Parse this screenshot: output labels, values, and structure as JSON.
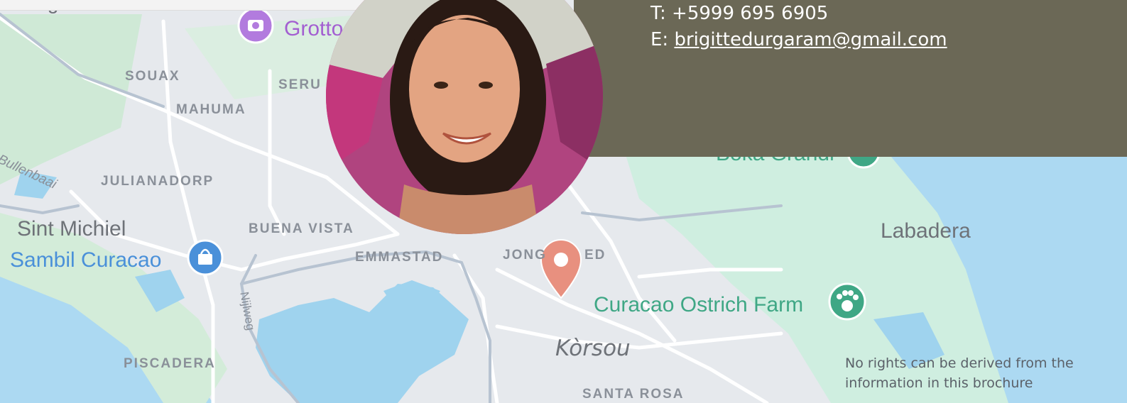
{
  "map": {
    "places": [
      {
        "id": "souax",
        "label": "SOUAX",
        "kind": "district"
      },
      {
        "id": "seru",
        "label": "SERU",
        "kind": "district"
      },
      {
        "id": "mahuma",
        "label": "MAHUMA",
        "kind": "district"
      },
      {
        "id": "julianadorp",
        "label": "JULIANADORP",
        "kind": "district"
      },
      {
        "id": "buena-vista",
        "label": "BUENA VISTA",
        "kind": "district"
      },
      {
        "id": "emmastad",
        "label": "EMMASTAD",
        "kind": "district"
      },
      {
        "id": "jongbloed-start",
        "label": "JONG",
        "kind": "district"
      },
      {
        "id": "jongbloed-end",
        "label": "ED",
        "kind": "district"
      },
      {
        "id": "piscadera",
        "label": "PISCADERA",
        "kind": "district"
      },
      {
        "id": "santa-rosa",
        "label": "SANTA ROSA",
        "kind": "district"
      },
      {
        "id": "sint-michiel",
        "label": "Sint Michiel",
        "kind": "town"
      },
      {
        "id": "labadera",
        "label": "Labadera",
        "kind": "town"
      },
      {
        "id": "korsou",
        "label": "Kòrsou",
        "kind": "region"
      },
      {
        "id": "bullenbaai",
        "label": "Bullenbaai",
        "kind": "road"
      },
      {
        "id": "nijlweg",
        "label": "Nijlweg",
        "kind": "road"
      },
      {
        "id": "boka-grandi",
        "label": "Boka Grandi",
        "kind": "poi-partial"
      },
      {
        "id": "berg-partial",
        "label": "e Berg",
        "kind": "town-partial"
      }
    ],
    "pois": [
      {
        "id": "grotto",
        "label": "Grotto",
        "icon": "camera-icon",
        "color": "#a764d6"
      },
      {
        "id": "sambil",
        "label": "Sambil Curacao",
        "icon": "shopping-bag-icon",
        "color": "#4a90d9"
      },
      {
        "id": "ostrich",
        "label": "Curacao Ostrich Farm",
        "icon": "paw-icon",
        "color": "#3fa785"
      }
    ],
    "marker": {
      "icon": "map-pin-icon",
      "color": "#e8907f"
    },
    "colors": {
      "water": "#aadaff",
      "land": "#e8eaed",
      "green": "#c8ebd4",
      "road": "#ffffff"
    }
  },
  "contact": {
    "phone": "T: +5999 695 6905",
    "email_prefix": "E: ",
    "email": "brigittedurgaram@gmail.com",
    "background": "#6b6856"
  },
  "profile": {
    "alt": "Portrait of a smiling woman with dark hair"
  },
  "disclaimer": {
    "line1": "No rights can be derived from the",
    "line2": "information in this brochure"
  }
}
